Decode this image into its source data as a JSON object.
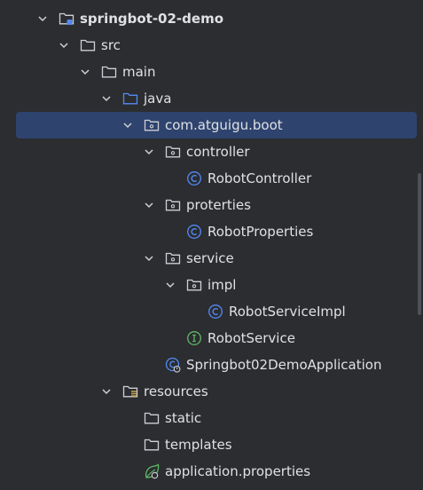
{
  "tree": [
    {
      "label": "springbot-02-demo",
      "icon": "module-folder-icon",
      "expanded": true,
      "bold": true
    },
    {
      "label": "src",
      "icon": "folder-icon",
      "expanded": true
    },
    {
      "label": "main",
      "icon": "folder-icon",
      "expanded": true
    },
    {
      "label": "java",
      "icon": "source-root-folder-icon",
      "expanded": true
    },
    {
      "label": "com.atguigu.boot",
      "icon": "package-icon",
      "expanded": true,
      "selected": true
    },
    {
      "label": "controller",
      "icon": "package-icon",
      "expanded": true
    },
    {
      "label": "RobotController",
      "icon": "class-icon"
    },
    {
      "label": "proterties",
      "icon": "package-icon",
      "expanded": true
    },
    {
      "label": "RobotProperties",
      "icon": "class-icon"
    },
    {
      "label": "service",
      "icon": "package-icon",
      "expanded": true
    },
    {
      "label": "impl",
      "icon": "package-icon",
      "expanded": true
    },
    {
      "label": "RobotServiceImpl",
      "icon": "class-icon"
    },
    {
      "label": "RobotService",
      "icon": "interface-icon"
    },
    {
      "label": "Springbot02DemoApplication",
      "icon": "spring-boot-class-icon"
    },
    {
      "label": "resources",
      "icon": "resources-folder-icon",
      "expanded": true
    },
    {
      "label": "static",
      "icon": "folder-icon"
    },
    {
      "label": "templates",
      "icon": "folder-icon"
    },
    {
      "label": "application.properties",
      "icon": "spring-properties-icon"
    }
  ],
  "colors": {
    "background": "#2b2d30",
    "selection": "#2e436e",
    "text": "#dfe1e5",
    "folder_outline": "#ced0d6",
    "source_root": "#548af7",
    "class_accent": "#548af7",
    "interface_accent": "#5fb865",
    "spring_accent": "#5fb865",
    "resources_accent": "#c7a450"
  }
}
